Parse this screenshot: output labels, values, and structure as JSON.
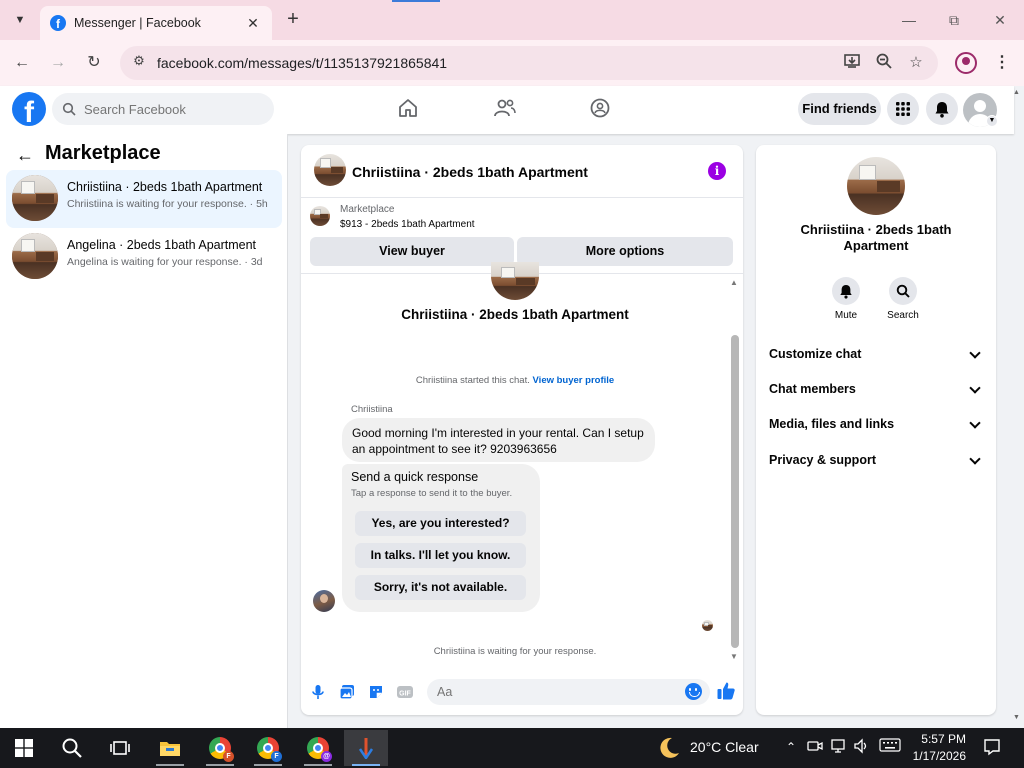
{
  "browser": {
    "tab_title": "Messenger | Facebook",
    "url": "facebook.com/messages/t/1135137921865841"
  },
  "header": {
    "search_placeholder": "Search Facebook",
    "find_friends": "Find friends"
  },
  "sidebar": {
    "title": "Marketplace",
    "conversations": [
      {
        "title": "Chriistiina · 2beds 1bath Apartment",
        "subtitle": "Chriistiina is waiting for your response. · 5h"
      },
      {
        "title": "Angelina · 2beds 1bath Apartment",
        "subtitle": "Angelina is waiting for your response. · 3d"
      }
    ]
  },
  "chat": {
    "title": "Chriistiina · 2beds 1bath Apartment",
    "listing_label": "Marketplace",
    "listing_price": "$913 - 2beds 1bath Apartment",
    "view_buyer": "View buyer",
    "more_options": "More options",
    "center_name": "Chriistiina · 2beds 1bath Apartment",
    "started_text": "Chriistiina started this chat.",
    "view_profile": "View buyer profile",
    "sender": "Chriistiina",
    "message": "Good morning I'm interested in your rental. Can I setup an appointment to see it? 9203963656",
    "quick_title": "Send a quick response",
    "quick_sub": "Tap a response to send it to the buyer.",
    "quick_replies": [
      "Yes, are you interested?",
      "In talks. I'll let you know.",
      "Sorry, it's not available."
    ],
    "waiting": "Chriistiina is waiting for your response.",
    "compose_placeholder": "Aa"
  },
  "info_panel": {
    "title": "Chriistiina · 2beds 1bath Apartment",
    "mute": "Mute",
    "search": "Search",
    "rows": [
      "Customize chat",
      "Chat members",
      "Media, files and links",
      "Privacy & support"
    ]
  },
  "taskbar": {
    "weather": "20°C  Clear",
    "time": "5:57 PM",
    "date": "1/17/2026"
  },
  "colors": {
    "fb_blue": "#1877f2",
    "active_conversation": "#ebf5ff",
    "info_purple": "#9b00e3",
    "tab_strip": "#f6dbe4"
  }
}
